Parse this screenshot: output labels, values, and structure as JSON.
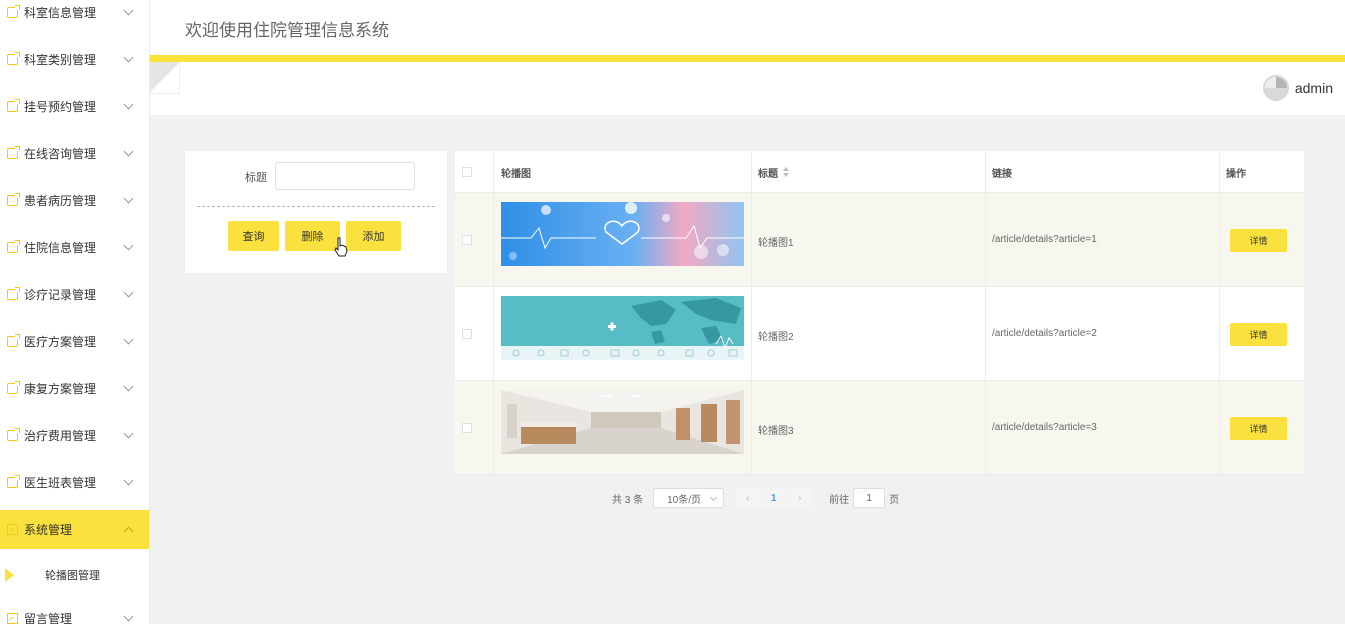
{
  "app": {
    "title": "欢迎使用住院管理信息系统",
    "accent": "#fbe13d"
  },
  "sidebar": {
    "items": [
      {
        "label": "科室信息管理"
      },
      {
        "label": "科室类别管理"
      },
      {
        "label": "挂号预约管理"
      },
      {
        "label": "在线咨询管理"
      },
      {
        "label": "患者病历管理"
      },
      {
        "label": "住院信息管理"
      },
      {
        "label": "诊疗记录管理"
      },
      {
        "label": "医疗方案管理"
      },
      {
        "label": "康复方案管理"
      },
      {
        "label": "治疗费用管理"
      },
      {
        "label": "医生班表管理"
      },
      {
        "label": "系统管理",
        "active": true
      },
      {
        "label": "留言管理"
      }
    ],
    "sub_item": {
      "label": "轮播图管理"
    }
  },
  "user": {
    "name": "admin"
  },
  "search": {
    "label": "标题",
    "value": "",
    "query_label": "查询",
    "delete_label": "删除",
    "add_label": "添加"
  },
  "table": {
    "headers": {
      "image": "轮播图",
      "title": "标题",
      "link": "链接",
      "action": "操作"
    },
    "rows": [
      {
        "title": "轮播图1",
        "link": "/article/details?article=1",
        "action": "详情"
      },
      {
        "title": "轮播图2",
        "link": "/article/details?article=2",
        "action": "详情"
      },
      {
        "title": "轮播图3",
        "link": "/article/details?article=3",
        "action": "详情"
      }
    ]
  },
  "pagination": {
    "total": "共 3 条",
    "page_size": "10条/页",
    "current": "1",
    "goto_label": "前往",
    "goto_value": "1",
    "page_suffix": "页"
  }
}
